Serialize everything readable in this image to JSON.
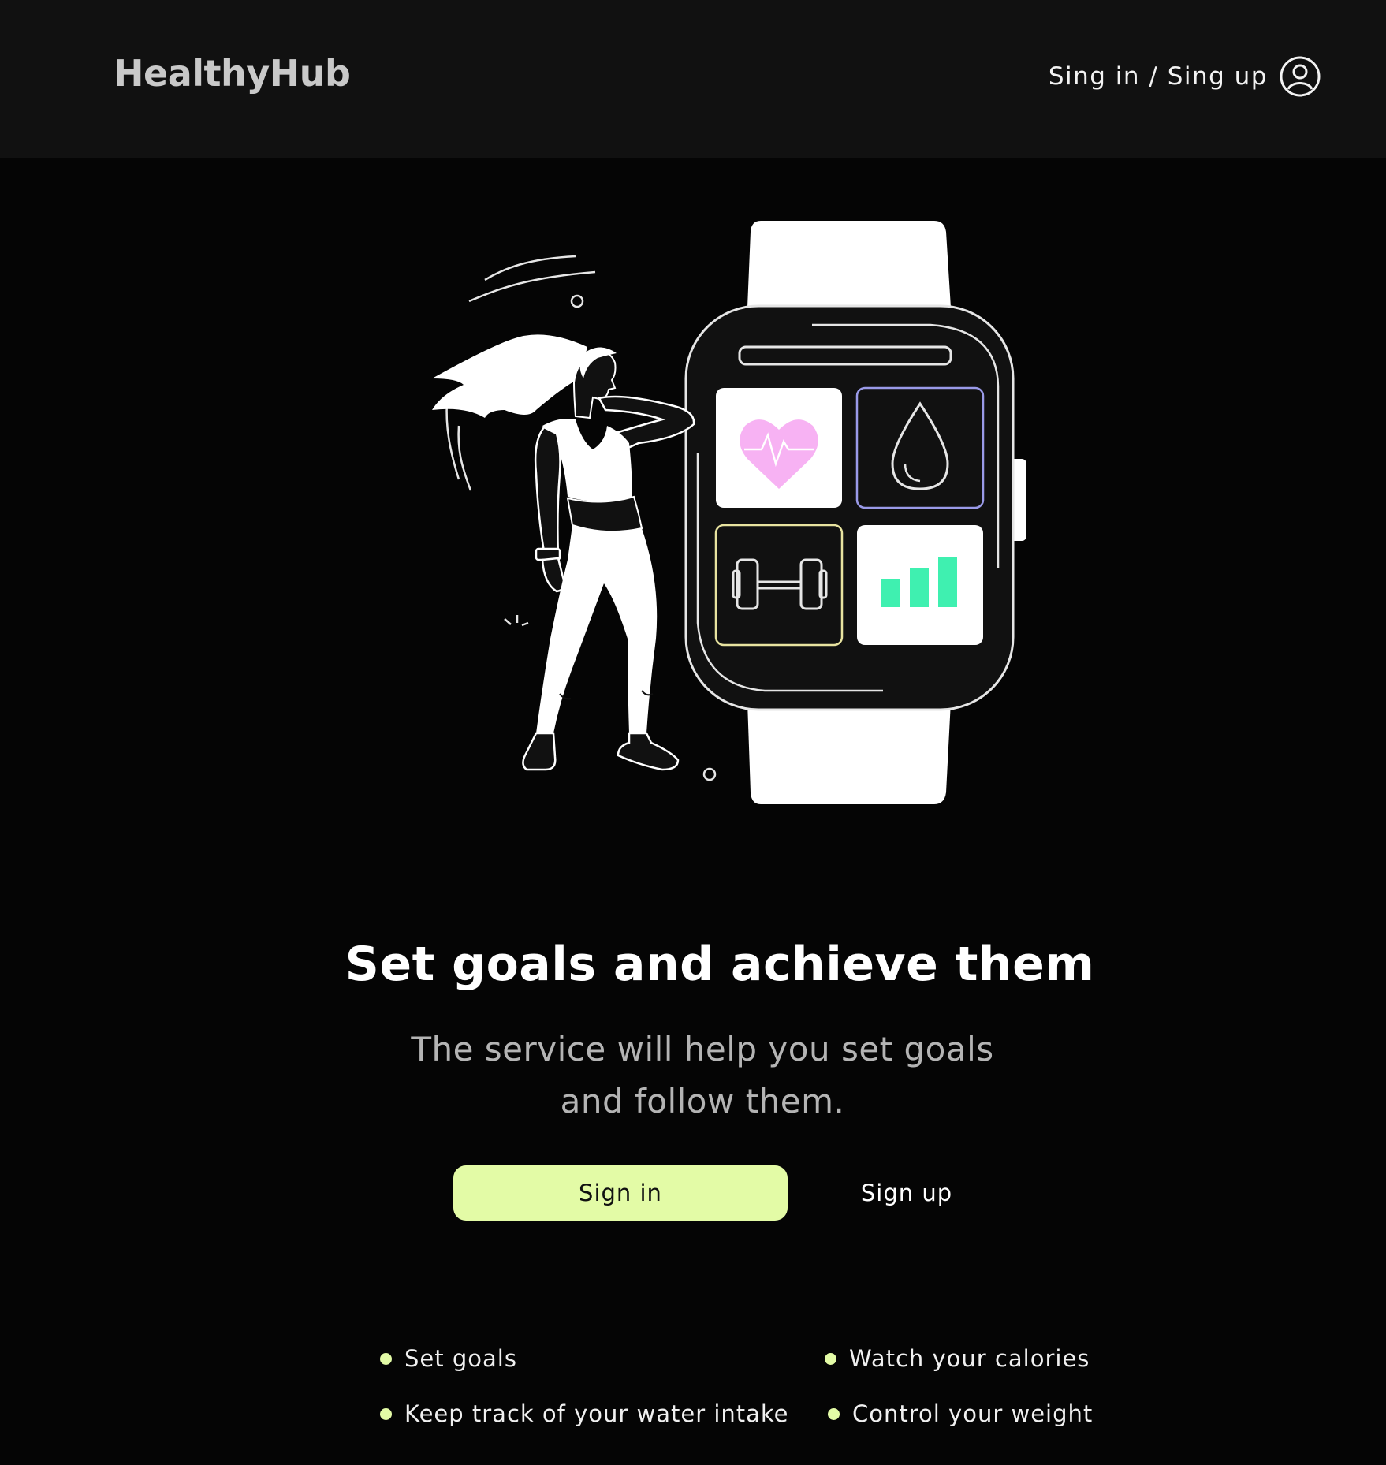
{
  "header": {
    "logo": "HealthyHub",
    "auth_link": "Sing in / Sing up",
    "auth_icon": "user-circle-icon"
  },
  "hero": {
    "illustration": "woman-with-smartwatch",
    "watch_tiles": [
      "heart-pulse-icon",
      "water-drop-icon",
      "dumbbell-icon",
      "bar-chart-icon"
    ]
  },
  "main": {
    "title": "Set goals and achieve them",
    "subtitle_line1": "The service will help you set goals",
    "subtitle_line2": "and follow them."
  },
  "actions": {
    "sign_in": "Sign in",
    "sign_up": "Sign up"
  },
  "features": [
    "Set goals",
    "Watch your calories",
    "Keep track of your water intake",
    "Control your weight"
  ],
  "colors": {
    "accent": "#e3fba6",
    "background": "#050505",
    "header": "#111111",
    "heart": "#f7b2f3",
    "chart": "#3ff0b0",
    "drop_outline": "#9a9ae8",
    "dumbbell_outline": "#e8e3a0"
  }
}
